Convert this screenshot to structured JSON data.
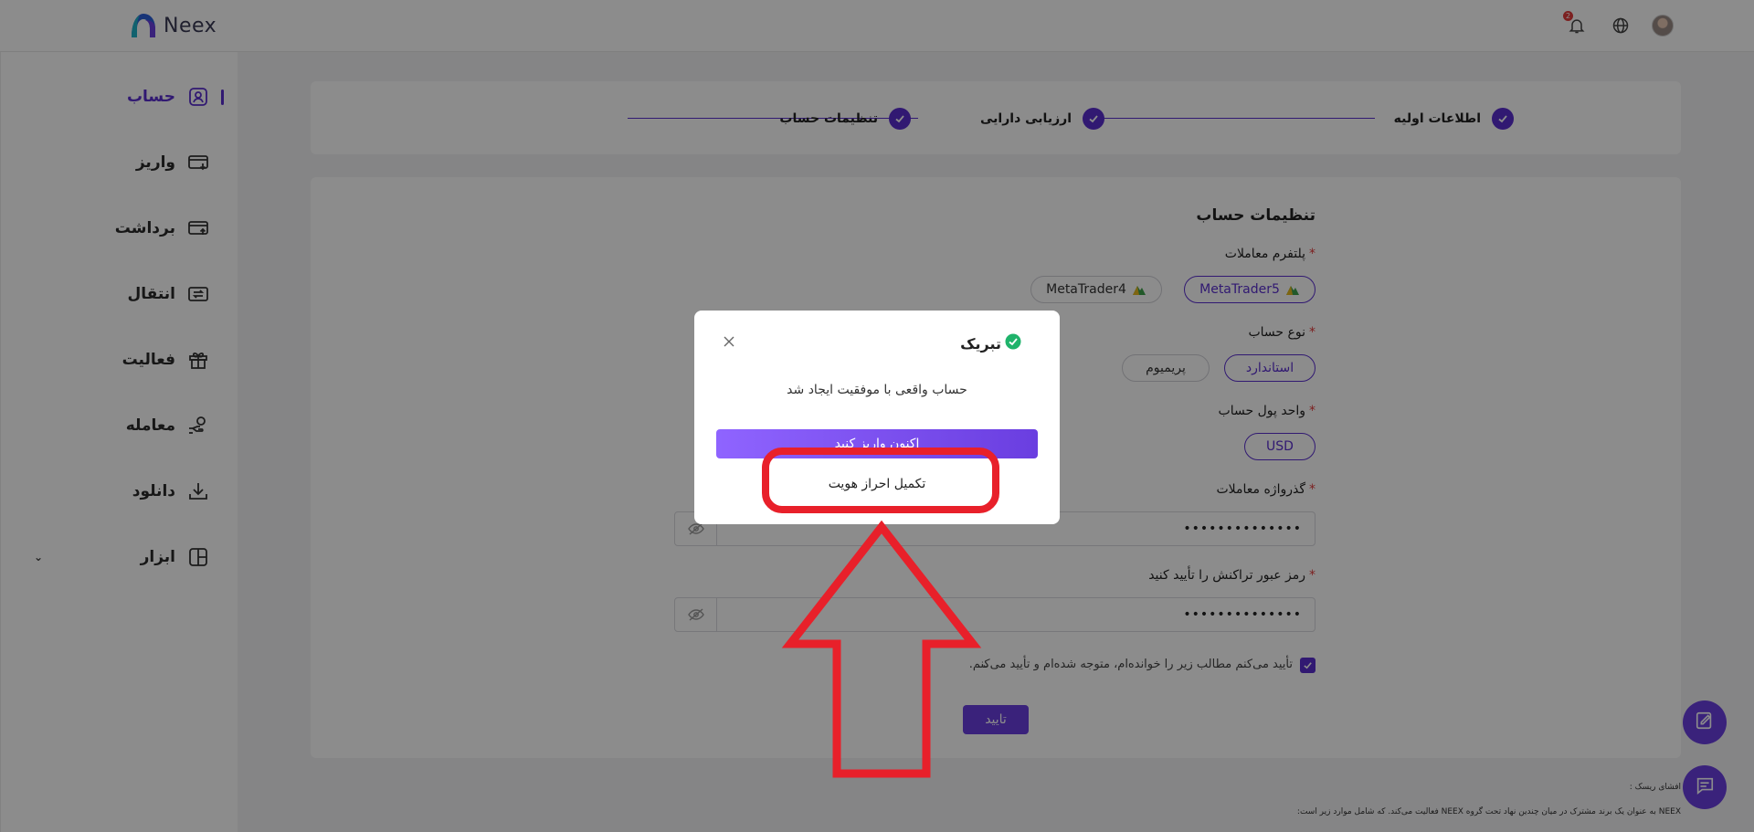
{
  "header": {
    "logo_text": "Neex",
    "notification_count": "2",
    "icons": [
      "bell-icon",
      "globe-icon",
      "avatar"
    ]
  },
  "sidebar": {
    "items": [
      {
        "label": "حساب",
        "icon": "user-account-icon",
        "active": true
      },
      {
        "label": "واریز",
        "icon": "deposit-icon"
      },
      {
        "label": "برداشت",
        "icon": "withdraw-icon"
      },
      {
        "label": "انتقال",
        "icon": "transfer-icon"
      },
      {
        "label": "فعالیت",
        "icon": "gift-icon"
      },
      {
        "label": "معامله",
        "icon": "trade-icon"
      },
      {
        "label": "دانلود",
        "icon": "download-icon"
      },
      {
        "label": "ابزار",
        "icon": "tools-icon"
      }
    ]
  },
  "stepper": {
    "steps": [
      {
        "label": "اطلاعات اولیه",
        "done": true
      },
      {
        "label": "ارزیابی دارایی",
        "done": true
      },
      {
        "label": "تنظیمات حساب",
        "done": true
      }
    ]
  },
  "form": {
    "title": "تنظیمات حساب",
    "platform_label": "پلتفرم معاملات",
    "platform_options": [
      "MetaTrader5",
      "MetaTrader4"
    ],
    "platform_selected": "MetaTrader5",
    "account_type_label": "نوع حساب",
    "account_type_options": [
      "استاندارد",
      "پریمیوم"
    ],
    "account_type_selected": "استاندارد",
    "currency_label": "واحد پول حساب",
    "currency_value": "USD",
    "password_label": "گذرواژه معاملات",
    "password_value": "••••••••••••••",
    "tx_password_label": "رمز عبور تراکنش را تأیید کنید",
    "tx_password_value": "••••••••••••••",
    "agree_text": "تأیید می‌کنم مطالب زیر را خوانده‌ام، متوجه شده‌ام و تأیید می‌کنم.",
    "agree_checked": true,
    "submit_label": "تایید"
  },
  "risk": {
    "title": "افشای ریسک :",
    "text": "NEEX به عنوان یک برند مشترک در میان چندین نهاد تحت گروه NEEX فعالیت می‌کند. که شامل موارد زیر است:"
  },
  "modal": {
    "title": "تبریک",
    "message": "حساب واقعی با موفقیت ایجاد شد",
    "primary_label": "اکنون واریز کنید",
    "secondary_label": "تکمیل احراز هویت"
  },
  "colors": {
    "accent": "#5a2fcf",
    "success": "#1fb36b",
    "annotation": "#e8202a"
  }
}
